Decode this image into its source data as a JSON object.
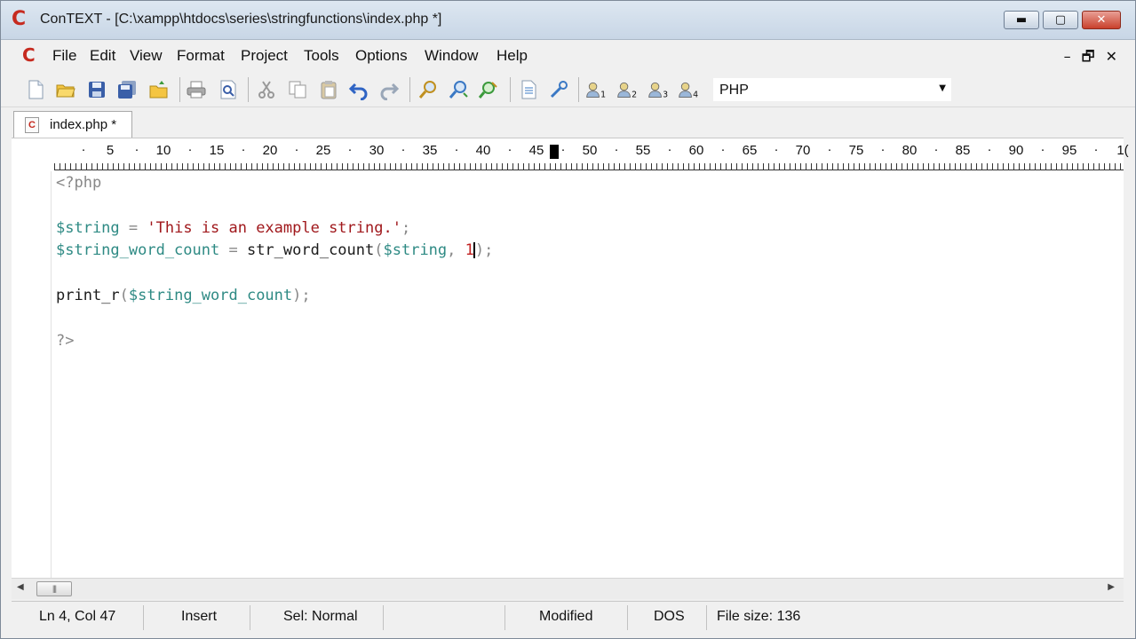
{
  "window": {
    "title": "ConTEXT - [C:\\xampp\\htdocs\\series\\stringfunctions\\index.php *]",
    "app_icon_glyph": "C",
    "controls": {
      "minimize": "▬",
      "maximize": "▢",
      "close": "✕"
    }
  },
  "menubar": {
    "icon_glyph": "C",
    "items": [
      "File",
      "Edit",
      "View",
      "Format",
      "Project",
      "Tools",
      "Options",
      "Window",
      "Help"
    ],
    "mdi_controls": [
      "–",
      "🗗",
      "✕"
    ]
  },
  "toolbar": {
    "icons": [
      "new-file-icon",
      "open-folder-icon",
      "save-icon",
      "save-all-icon",
      "open-project-icon",
      "print-icon",
      "print-preview-icon",
      "cut-icon",
      "copy-icon",
      "paste-icon",
      "undo-icon",
      "redo-icon",
      "find-icon",
      "find-next-icon",
      "replace-icon",
      "file-info-icon",
      "tool-icon",
      "user-command-1-icon",
      "user-command-2-icon",
      "user-command-3-icon",
      "user-command-4-icon"
    ],
    "user_command_numbers": [
      "1",
      "2",
      "3",
      "4"
    ],
    "language": "PHP"
  },
  "tabs": [
    {
      "label": "index.php *",
      "icon_glyph": "C"
    }
  ],
  "ruler": {
    "numbers": [
      "5",
      "10",
      "15",
      "20",
      "25",
      "30",
      "35",
      "40",
      "45",
      "50",
      "55",
      "60",
      "65",
      "70",
      "75",
      "80",
      "85",
      "90",
      "95",
      "1("
    ],
    "dot": "·"
  },
  "editor": {
    "line1": "<?php",
    "line3_var": "$string",
    "line3_op": " = ",
    "line3_str": "'This is an example string.'",
    "line3_end": ";",
    "line4_var": "$string_word_count",
    "line4_op": " = ",
    "line4_fn": "str_word_count",
    "line4_paren_open": "(",
    "line4_arg": "$string",
    "line4_comma": ", ",
    "line4_num": "1",
    "line4_end": ");",
    "line6_fn": "print_r",
    "line6_paren_open": "(",
    "line6_arg": "$string_word_count",
    "line6_end": ");",
    "line8": "?>"
  },
  "scrollbar": {
    "left_arrow": "◀",
    "thumb_grip": "|||",
    "right_arrow": "▶"
  },
  "statusbar": {
    "position": "Ln 4, Col 47",
    "mode": "Insert",
    "selection": "Sel: Normal",
    "modified": "Modified",
    "line_ending": "DOS",
    "file_size": "File size: 136"
  },
  "colors": {
    "string": "#a0181c",
    "variable": "#2e8a84",
    "punctuation": "#888888",
    "number": "#c02020",
    "app_icon": "#c62a1f"
  }
}
